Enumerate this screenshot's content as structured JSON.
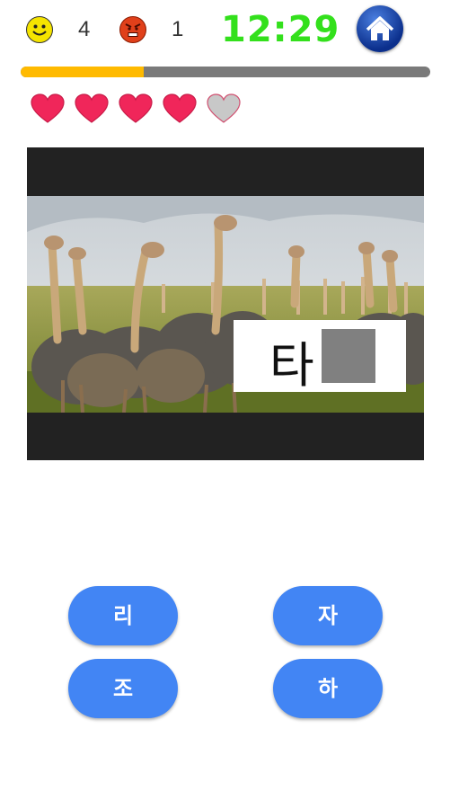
{
  "header": {
    "correct_icon": "smiley-face-icon",
    "correct_count": "4",
    "wrong_icon": "angry-face-icon",
    "wrong_count": "1",
    "timer": "12:29",
    "home_icon": "home-icon"
  },
  "progress": {
    "value": 0.3,
    "fill_color": "#ffba00",
    "track_color": "#7a7a7a"
  },
  "lives": {
    "total": 5,
    "remaining": 4,
    "full_color": "#f0265a",
    "empty_color": "#c8c8c8"
  },
  "puzzle": {
    "image": "ostriches-photo",
    "known_syllable": "타",
    "blank": "missing-syllable"
  },
  "answers": [
    {
      "label": "리"
    },
    {
      "label": "자"
    },
    {
      "label": "조"
    },
    {
      "label": "하"
    }
  ],
  "colors": {
    "timer": "#33e01c",
    "button": "#4285f4"
  }
}
